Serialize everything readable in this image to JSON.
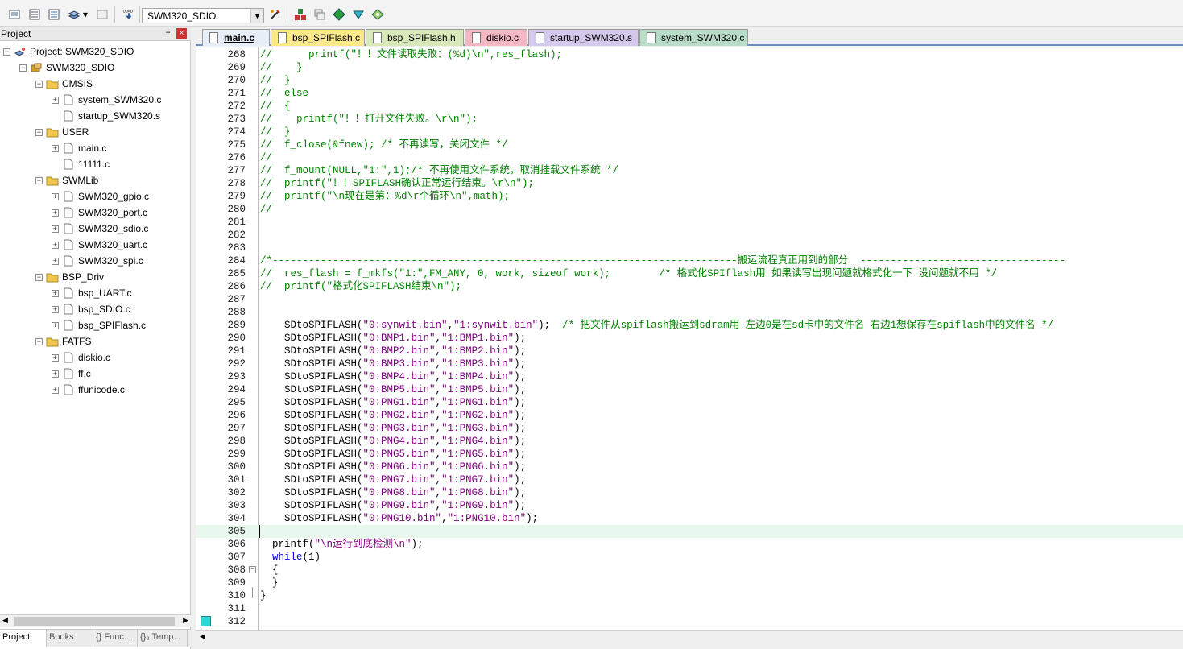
{
  "toolbar": {
    "target": "SWM320_SDIO",
    "load_label": "LOAD"
  },
  "project_panel": {
    "title": "Project",
    "pin": "ᚐ",
    "close": "×",
    "tree": [
      {
        "label": "Project: SWM320_SDIO",
        "level": 0,
        "type": "project",
        "expander": "−"
      },
      {
        "label": "SWM320_SDIO",
        "level": 1,
        "type": "target",
        "expander": "−"
      },
      {
        "label": "CMSIS",
        "level": 2,
        "type": "folder",
        "expander": "−"
      },
      {
        "label": "system_SWM320.c",
        "level": 3,
        "type": "file",
        "expander": "+"
      },
      {
        "label": "startup_SWM320.s",
        "level": 3,
        "type": "file",
        "expander": ""
      },
      {
        "label": "USER",
        "level": 2,
        "type": "folder",
        "expander": "−"
      },
      {
        "label": "main.c",
        "level": 3,
        "type": "file",
        "expander": "+"
      },
      {
        "label": "11111.c",
        "level": 3,
        "type": "file",
        "expander": ""
      },
      {
        "label": "SWMLib",
        "level": 2,
        "type": "folder",
        "expander": "−"
      },
      {
        "label": "SWM320_gpio.c",
        "level": 3,
        "type": "file",
        "expander": "+"
      },
      {
        "label": "SWM320_port.c",
        "level": 3,
        "type": "file",
        "expander": "+"
      },
      {
        "label": "SWM320_sdio.c",
        "level": 3,
        "type": "file",
        "expander": "+"
      },
      {
        "label": "SWM320_uart.c",
        "level": 3,
        "type": "file",
        "expander": "+"
      },
      {
        "label": "SWM320_spi.c",
        "level": 3,
        "type": "file",
        "expander": "+"
      },
      {
        "label": "BSP_Driv",
        "level": 2,
        "type": "folder",
        "expander": "−"
      },
      {
        "label": "bsp_UART.c",
        "level": 3,
        "type": "file",
        "expander": "+"
      },
      {
        "label": "bsp_SDIO.c",
        "level": 3,
        "type": "file",
        "expander": "+"
      },
      {
        "label": "bsp_SPIFlash.c",
        "level": 3,
        "type": "file",
        "expander": "+"
      },
      {
        "label": "FATFS",
        "level": 2,
        "type": "folder",
        "expander": "−"
      },
      {
        "label": "diskio.c",
        "level": 3,
        "type": "file",
        "expander": "+"
      },
      {
        "label": "ff.c",
        "level": 3,
        "type": "file",
        "expander": "+"
      },
      {
        "label": "ffunicode.c",
        "level": 3,
        "type": "file",
        "expander": "+"
      }
    ],
    "bottom_tabs": [
      "Project",
      "Books",
      "{} Func...",
      "{}₂ Temp..."
    ]
  },
  "file_tabs": [
    {
      "label": "main.c",
      "color": "#e8eef8",
      "active": true
    },
    {
      "label": "bsp_SPIFlash.c",
      "color": "#fbe98b"
    },
    {
      "label": "bsp_SPIFlash.h",
      "color": "#d9e8b8"
    },
    {
      "label": "diskio.c",
      "color": "#f4b8c4"
    },
    {
      "label": "startup_SWM320.s",
      "color": "#d4c8ec"
    },
    {
      "label": "system_SWM320.c",
      "color": "#b8dcc8"
    }
  ],
  "editor": {
    "current_line": "305",
    "lines": [
      {
        "n": "268",
        "parts": [
          [
            "c",
            "//      printf(\"！！文件读取失败：(%d)\\n\",res_flash);"
          ]
        ]
      },
      {
        "n": "269",
        "parts": [
          [
            "c",
            "//    }"
          ]
        ]
      },
      {
        "n": "270",
        "parts": [
          [
            "c",
            "//  }"
          ]
        ]
      },
      {
        "n": "271",
        "parts": [
          [
            "c",
            "//  else"
          ]
        ]
      },
      {
        "n": "272",
        "parts": [
          [
            "c",
            "//  {"
          ]
        ]
      },
      {
        "n": "273",
        "parts": [
          [
            "c",
            "//    printf(\"！！打开文件失败。\\r\\n\");"
          ]
        ]
      },
      {
        "n": "274",
        "parts": [
          [
            "c",
            "//  }"
          ]
        ]
      },
      {
        "n": "275",
        "parts": [
          [
            "c",
            "//  f_close(&fnew); /* 不再读写，关闭文件 */"
          ]
        ]
      },
      {
        "n": "276",
        "parts": [
          [
            "c",
            "//"
          ]
        ]
      },
      {
        "n": "277",
        "parts": [
          [
            "c",
            "//  f_mount(NULL,\"1:\",1);/* 不再使用文件系统，取消挂载文件系统 */"
          ]
        ]
      },
      {
        "n": "278",
        "parts": [
          [
            "c",
            "//  printf(\"！！SPIFLASH确认正常运行结束。\\r\\n\");"
          ]
        ]
      },
      {
        "n": "279",
        "parts": [
          [
            "c",
            "//  printf(\"\\n现在是第：%d\\r个循环\\n\",math);"
          ]
        ]
      },
      {
        "n": "280",
        "parts": [
          [
            "c",
            "//"
          ]
        ]
      },
      {
        "n": "281",
        "parts": []
      },
      {
        "n": "282",
        "parts": []
      },
      {
        "n": "283",
        "parts": []
      },
      {
        "n": "284",
        "parts": [
          [
            "c",
            "/*-----------------------------------------------------------------------------搬运流程真正用到的部分  ----------------------------------"
          ]
        ]
      },
      {
        "n": "285",
        "parts": [
          [
            "c",
            "//  res_flash = f_mkfs(\"1:\",FM_ANY, 0, work, sizeof work);        /* 格式化SPIflash用 如果读写出现问题就格式化一下 没问题就不用 */"
          ]
        ]
      },
      {
        "n": "286",
        "parts": [
          [
            "c",
            "//  printf(\"格式化SPIFLASH结束\\n\");"
          ]
        ]
      },
      {
        "n": "287",
        "parts": []
      },
      {
        "n": "288",
        "parts": []
      },
      {
        "n": "289",
        "parts": [
          [
            "p",
            "    SDtoSPIFLASH("
          ],
          [
            "s",
            "\"0:synwit.bin\""
          ],
          [
            "p",
            ","
          ],
          [
            "s",
            "\"1:synwit.bin\""
          ],
          [
            "p",
            ");  "
          ],
          [
            "c",
            "/* 把文件从spiflash搬运到sdram用 左边0是在sd卡中的文件名 右边1想保存在spiflash中的文件名 */"
          ]
        ]
      },
      {
        "n": "290",
        "parts": [
          [
            "p",
            "    SDtoSPIFLASH("
          ],
          [
            "s",
            "\"0:BMP1.bin\""
          ],
          [
            "p",
            ","
          ],
          [
            "s",
            "\"1:BMP1.bin\""
          ],
          [
            "p",
            ");"
          ]
        ]
      },
      {
        "n": "291",
        "parts": [
          [
            "p",
            "    SDtoSPIFLASH("
          ],
          [
            "s",
            "\"0:BMP2.bin\""
          ],
          [
            "p",
            ","
          ],
          [
            "s",
            "\"1:BMP2.bin\""
          ],
          [
            "p",
            ");"
          ]
        ]
      },
      {
        "n": "292",
        "parts": [
          [
            "p",
            "    SDtoSPIFLASH("
          ],
          [
            "s",
            "\"0:BMP3.bin\""
          ],
          [
            "p",
            ","
          ],
          [
            "s",
            "\"1:BMP3.bin\""
          ],
          [
            "p",
            ");"
          ]
        ]
      },
      {
        "n": "293",
        "parts": [
          [
            "p",
            "    SDtoSPIFLASH("
          ],
          [
            "s",
            "\"0:BMP4.bin\""
          ],
          [
            "p",
            ","
          ],
          [
            "s",
            "\"1:BMP4.bin\""
          ],
          [
            "p",
            ");"
          ]
        ]
      },
      {
        "n": "294",
        "parts": [
          [
            "p",
            "    SDtoSPIFLASH("
          ],
          [
            "s",
            "\"0:BMP5.bin\""
          ],
          [
            "p",
            ","
          ],
          [
            "s",
            "\"1:BMP5.bin\""
          ],
          [
            "p",
            ");"
          ]
        ]
      },
      {
        "n": "295",
        "parts": [
          [
            "p",
            "    SDtoSPIFLASH("
          ],
          [
            "s",
            "\"0:PNG1.bin\""
          ],
          [
            "p",
            ","
          ],
          [
            "s",
            "\"1:PNG1.bin\""
          ],
          [
            "p",
            ");"
          ]
        ]
      },
      {
        "n": "296",
        "parts": [
          [
            "p",
            "    SDtoSPIFLASH("
          ],
          [
            "s",
            "\"0:PNG2.bin\""
          ],
          [
            "p",
            ","
          ],
          [
            "s",
            "\"1:PNG2.bin\""
          ],
          [
            "p",
            ");"
          ]
        ]
      },
      {
        "n": "297",
        "parts": [
          [
            "p",
            "    SDtoSPIFLASH("
          ],
          [
            "s",
            "\"0:PNG3.bin\""
          ],
          [
            "p",
            ","
          ],
          [
            "s",
            "\"1:PNG3.bin\""
          ],
          [
            "p",
            ");"
          ]
        ]
      },
      {
        "n": "298",
        "parts": [
          [
            "p",
            "    SDtoSPIFLASH("
          ],
          [
            "s",
            "\"0:PNG4.bin\""
          ],
          [
            "p",
            ","
          ],
          [
            "s",
            "\"1:PNG4.bin\""
          ],
          [
            "p",
            ");"
          ]
        ]
      },
      {
        "n": "299",
        "parts": [
          [
            "p",
            "    SDtoSPIFLASH("
          ],
          [
            "s",
            "\"0:PNG5.bin\""
          ],
          [
            "p",
            ","
          ],
          [
            "s",
            "\"1:PNG5.bin\""
          ],
          [
            "p",
            ");"
          ]
        ]
      },
      {
        "n": "300",
        "parts": [
          [
            "p",
            "    SDtoSPIFLASH("
          ],
          [
            "s",
            "\"0:PNG6.bin\""
          ],
          [
            "p",
            ","
          ],
          [
            "s",
            "\"1:PNG6.bin\""
          ],
          [
            "p",
            ");"
          ]
        ]
      },
      {
        "n": "301",
        "parts": [
          [
            "p",
            "    SDtoSPIFLASH("
          ],
          [
            "s",
            "\"0:PNG7.bin\""
          ],
          [
            "p",
            ","
          ],
          [
            "s",
            "\"1:PNG7.bin\""
          ],
          [
            "p",
            ");"
          ]
        ]
      },
      {
        "n": "302",
        "parts": [
          [
            "p",
            "    SDtoSPIFLASH("
          ],
          [
            "s",
            "\"0:PNG8.bin\""
          ],
          [
            "p",
            ","
          ],
          [
            "s",
            "\"1:PNG8.bin\""
          ],
          [
            "p",
            ");"
          ]
        ]
      },
      {
        "n": "303",
        "parts": [
          [
            "p",
            "    SDtoSPIFLASH("
          ],
          [
            "s",
            "\"0:PNG9.bin\""
          ],
          [
            "p",
            ","
          ],
          [
            "s",
            "\"1:PNG9.bin\""
          ],
          [
            "p",
            ");"
          ]
        ]
      },
      {
        "n": "304",
        "parts": [
          [
            "p",
            "    SDtoSPIFLASH("
          ],
          [
            "s",
            "\"0:PNG10.bin\""
          ],
          [
            "p",
            ","
          ],
          [
            "s",
            "\"1:PNG10.bin\""
          ],
          [
            "p",
            ");"
          ]
        ]
      },
      {
        "n": "305",
        "parts": []
      },
      {
        "n": "306",
        "parts": [
          [
            "p",
            "  printf("
          ],
          [
            "s",
            "\"\\n运行到底检测\\n\""
          ],
          [
            "p",
            ");"
          ]
        ]
      },
      {
        "n": "307",
        "parts": [
          [
            "k",
            "  while"
          ],
          [
            "p",
            "(1)"
          ]
        ]
      },
      {
        "n": "308",
        "parts": [
          [
            "p",
            "  {"
          ]
        ],
        "fold": "−"
      },
      {
        "n": "309",
        "parts": [
          [
            "p",
            "  }"
          ]
        ]
      },
      {
        "n": "310",
        "parts": [
          [
            "p",
            "}"
          ]
        ]
      },
      {
        "n": "311",
        "parts": []
      },
      {
        "n": "312",
        "parts": []
      }
    ]
  },
  "colors": {
    "comment": "#008000",
    "string": "#800080",
    "keyword": "#0000ff",
    "current_line_bg": "#e8f8ee"
  }
}
